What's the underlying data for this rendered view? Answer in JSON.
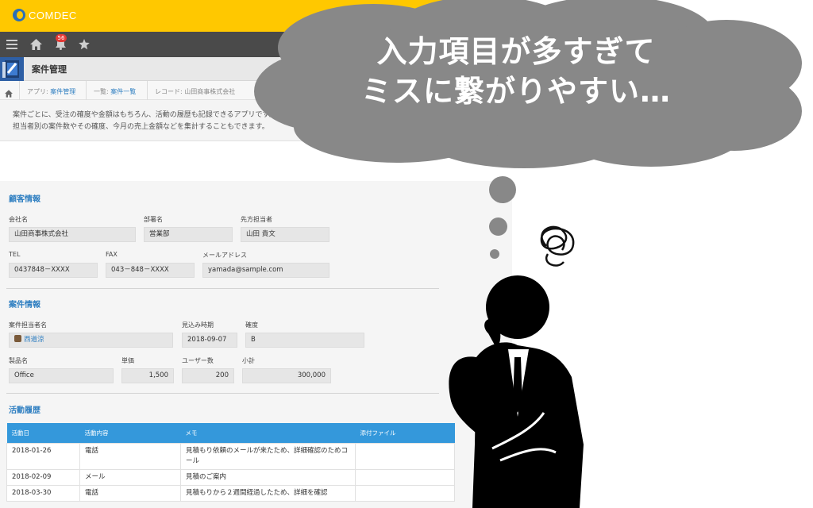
{
  "app": {
    "logo_text": "COMDEC",
    "notification_count": "56",
    "title": "案件管理"
  },
  "breadcrumb": {
    "app_prefix": "アプリ: ",
    "app_link": "案件管理",
    "list_prefix": "一覧: ",
    "list_link": "案件一覧",
    "record_prefix": "レコード: ",
    "record_name": "山田商事株式会社"
  },
  "description": {
    "line1": "案件ごとに、受注の確度や金額はもちろん、活動の履歴も記録できるアプリです。",
    "line2": "担当者別の案件数やその確度、今月の売上金額などを集計することもできます。"
  },
  "customer": {
    "section_title": "顧客情報",
    "company_label": "会社名",
    "company_value": "山田商事株式会社",
    "dept_label": "部署名",
    "dept_value": "営業部",
    "contact_label": "先方担当者",
    "contact_value": "山田 貴文",
    "tel_label": "TEL",
    "tel_value": "0437848－XXXX",
    "fax_label": "FAX",
    "fax_value": "043－848－XXXX",
    "email_label": "メールアドレス",
    "email_value": "yamada@sample.com"
  },
  "deal": {
    "section_title": "案件情報",
    "owner_label": "案件担当者名",
    "owner_value": "西道涼",
    "expected_label": "見込み時期",
    "expected_value": "2018-09-07",
    "certainty_label": "確度",
    "certainty_value": "B",
    "product_label": "製品名",
    "product_value": "Office",
    "price_label": "単価",
    "price_value": "1,500",
    "users_label": "ユーザー数",
    "users_value": "200",
    "subtotal_label": "小計",
    "subtotal_value": "300,000"
  },
  "activity": {
    "section_title": "活動履歴",
    "headers": [
      "活動日",
      "活動内容",
      "メモ",
      "添付ファイル"
    ],
    "rows": [
      {
        "date": "2018-01-26",
        "type": "電話",
        "memo": "見積もり依頼のメールが来たため、詳細確認のためコール",
        "file": ""
      },
      {
        "date": "2018-02-09",
        "type": "メール",
        "memo": "見積のご案内",
        "file": ""
      },
      {
        "date": "2018-03-30",
        "type": "電話",
        "memo": "見積もりから２週間経過したため、詳細を確認",
        "file": ""
      }
    ]
  },
  "thought": {
    "line1": "入力項目が多すぎて",
    "line2": "ミスに繋がりやすい…"
  },
  "colors": {
    "header_yellow": "#ffc800",
    "nav_dark": "#4a4a4a",
    "link_blue": "#2f7fc1",
    "table_header_blue": "#3498db",
    "cloud_gray": "#888888"
  },
  "icons": [
    "menu-icon",
    "home-icon",
    "bell-icon",
    "star-icon",
    "breadcrumb-home-icon",
    "user-icon",
    "confused-scribble-icon"
  ]
}
